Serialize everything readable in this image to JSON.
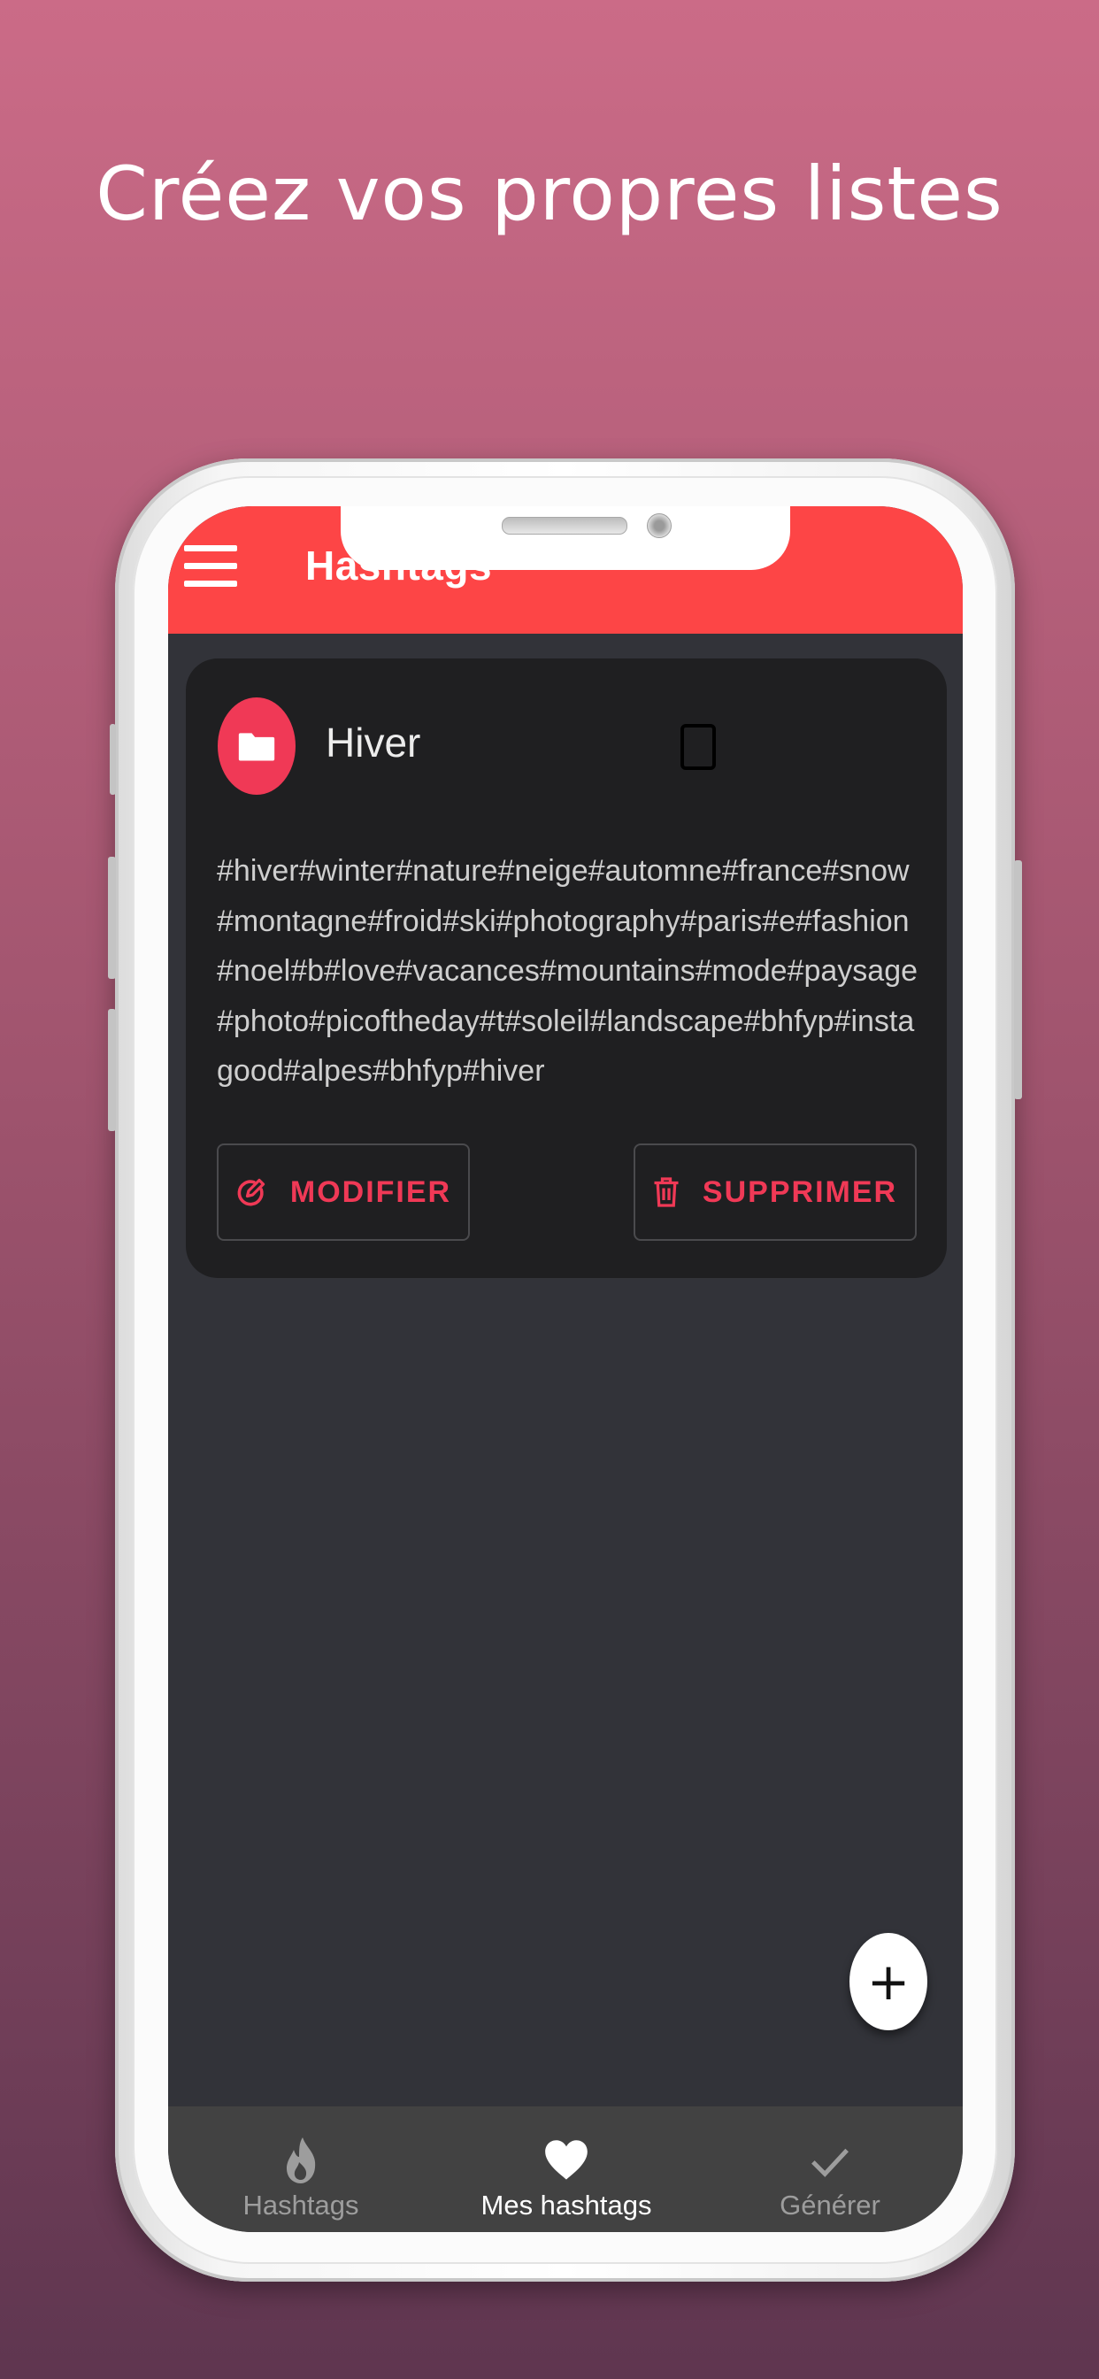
{
  "headline": "Créez vos propres listes",
  "appbar": {
    "title": "Hashtags",
    "menu_icon": "hamburger-menu-icon"
  },
  "card": {
    "icon": "folder-icon",
    "title": "Hiver",
    "checkbox_checked": false,
    "tags": "#hiver#winter#nature#neige#automne#france#snow#montagne#froid#ski#photography#paris#e#fashion#noel#b#love#vacances#mountains#mode#paysage#photo#picoftheday#t#soleil#landscape#bhfyp#instagood#alpes#bhfyp#hiver",
    "edit_label": "MODIFIER",
    "delete_label": "SUPPRIMER"
  },
  "fab": {
    "label": "+",
    "icon": "add-icon"
  },
  "bottom_nav": {
    "items": [
      {
        "label": "Hashtags",
        "icon": "flame-icon",
        "active": false
      },
      {
        "label": "Mes hashtags",
        "icon": "heart-icon",
        "active": true
      },
      {
        "label": "Générer",
        "icon": "check-icon",
        "active": false
      }
    ]
  },
  "colors": {
    "appbar": "#fd4546",
    "accent": "#f03956",
    "screen_bg": "#323339",
    "card_bg": "#1f1f21",
    "nav_bg": "#424242"
  }
}
